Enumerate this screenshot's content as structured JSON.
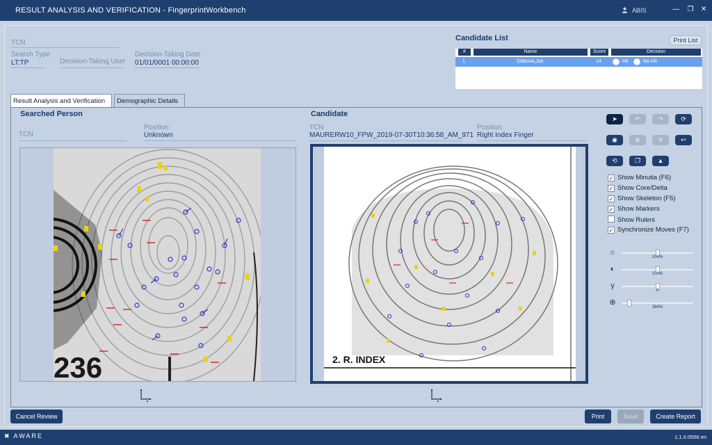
{
  "window": {
    "title": "RESULT ANALYSIS AND VERIFICATION - FingerprintWorkbench",
    "user": "ABIS"
  },
  "case": {
    "tcn_label": "TCN",
    "search_type_label": "Search Type",
    "search_type_value": "LT:TP",
    "decision_user_label": "Decision-Taking User",
    "decision_date_label": "Decision-Taking Date",
    "decision_date_value": "01/01/0001  00:00:00"
  },
  "candidates": {
    "title": "Candidate List",
    "print_list": "Print List",
    "columns": [
      "#",
      "Name",
      "Score",
      "Decision"
    ],
    "rows": [
      {
        "num": "1",
        "name": "Slabova,Joe",
        "score": "14",
        "hit": "Hit",
        "nohit": "No Hit"
      }
    ]
  },
  "tabs": [
    {
      "label": "Result Analysis and Verification",
      "active": true
    },
    {
      "label": "Demographic Details",
      "active": false
    }
  ],
  "searched": {
    "title": "Searched Person",
    "tcn_label": "TCN",
    "position_label": "Position",
    "position_value": "Unknown",
    "print_text": "236"
  },
  "candidate": {
    "title": "Candidate",
    "tcn_label": "TCN",
    "tcn_value": "MAURERW10_FPW_2019-07-30T10:36:58_AM_971",
    "position_label": "Position",
    "position_value": "Right Index Finger",
    "print_caption": "2. R. INDEX"
  },
  "options": [
    {
      "label": "Show Minutia  (F6)",
      "checked": true
    },
    {
      "label": "Show Core/Delta",
      "checked": true
    },
    {
      "label": "Show Skeleton  (F5)",
      "checked": true
    },
    {
      "label": "Show Markers",
      "checked": true
    },
    {
      "label": "Show Rulers",
      "checked": false
    },
    {
      "label": "Synchronize Moves  (F7)",
      "checked": true
    }
  ],
  "sliders": [
    {
      "name": "brightness",
      "icon": "sun-icon",
      "value": "100%",
      "level": 0.5
    },
    {
      "name": "contrast",
      "icon": "contrast-icon",
      "value": "100%",
      "level": 0.5
    },
    {
      "name": "gamma",
      "icon": "gamma-icon",
      "value": "0",
      "level": 0.5
    },
    {
      "name": "zoom",
      "icon": "zoom-icon",
      "value": "384%",
      "level": 0.08
    }
  ],
  "actions": {
    "cancel_review": "Cancel Review",
    "print": "Print",
    "save": "Save",
    "create_report": "Create Report"
  },
  "footer": {
    "brand": "AWARE",
    "version": "1.1.0.0556 en"
  },
  "colors": {
    "titlebar": "#1f3f6f",
    "panel": "#c5d2e4",
    "selected_row": "#6aa1ee",
    "minutia_red": "#d62020",
    "minutia_blue": "#2838c8",
    "minutia_yellow": "#e8d21a"
  }
}
